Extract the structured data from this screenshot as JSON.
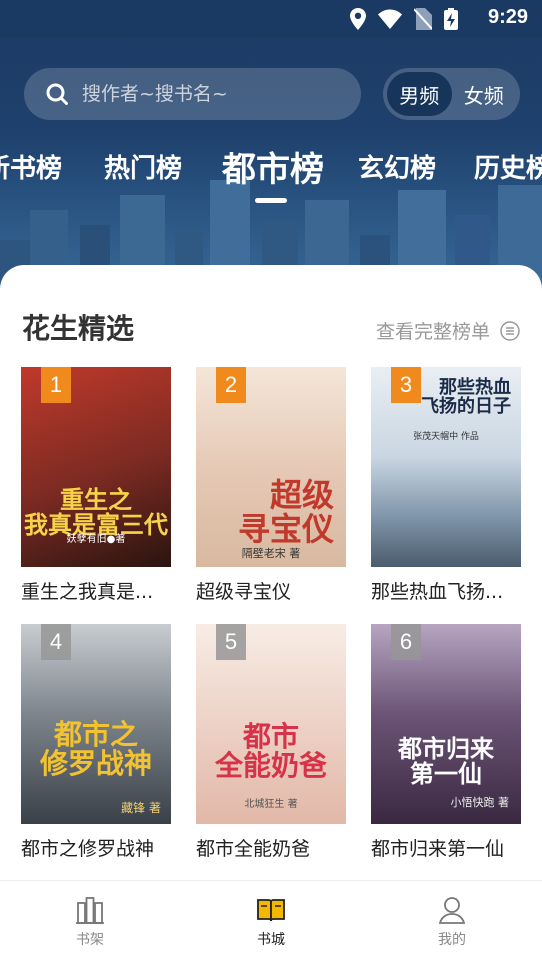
{
  "status": {
    "time": "9:29"
  },
  "search": {
    "placeholder": "搜作者~搜书名~"
  },
  "gender": {
    "options": [
      "男频",
      "女频"
    ],
    "selected": "男频"
  },
  "tabs": [
    {
      "label": "新书榜"
    },
    {
      "label": "热门榜"
    },
    {
      "label": "都市榜",
      "active": true
    },
    {
      "label": "玄幻榜"
    },
    {
      "label": "历史榜"
    }
  ],
  "section": {
    "title": "花生精选",
    "see_all": "查看完整榜单"
  },
  "books": [
    {
      "rank": "1",
      "title": "重生之我真是...",
      "cover_text": "重生之\n我真是富三代",
      "cover_author": "妖孽有旧●著",
      "cover_color": "#7a2a22"
    },
    {
      "rank": "2",
      "title": "超级寻宝仪",
      "cover_text": "超级\n寻宝仪",
      "cover_author": "隔壁老宋 著",
      "cover_color": "#e9d6c6"
    },
    {
      "rank": "3",
      "title": "那些热血飞扬...",
      "cover_text": "那些热血\n飞扬的日子",
      "cover_author": "张茂天帽中 作品",
      "cover_color": "#9bb0c4"
    },
    {
      "rank": "4",
      "title": "都市之修罗战神",
      "cover_text": "都市之\n修罗战神",
      "cover_author": "藏锋 著",
      "cover_color": "#3a4048"
    },
    {
      "rank": "5",
      "title": "都市全能奶爸",
      "cover_text": "都市\n全能奶爸",
      "cover_author": "北城狂生 著",
      "cover_color": "#efdcd2"
    },
    {
      "rank": "6",
      "title": "都市归来第一仙",
      "cover_text": "都市归来\n第一仙",
      "cover_author": "小悟快跑 著",
      "cover_color": "#4e3a56"
    }
  ],
  "navbar": [
    {
      "label": "书架",
      "icon": "bookshelf-icon"
    },
    {
      "label": "书城",
      "icon": "open-book-icon",
      "active": true
    },
    {
      "label": "我的",
      "icon": "profile-icon"
    }
  ],
  "colors": {
    "accent": "#f5b800",
    "rank_top": "#f08a1c",
    "hero": "#1f416d"
  }
}
